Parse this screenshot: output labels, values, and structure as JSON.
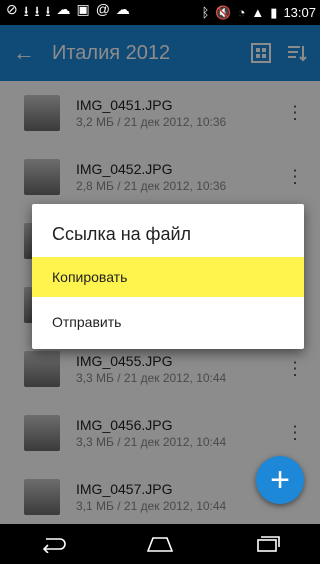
{
  "status_bar": {
    "time": "13:07"
  },
  "app_bar": {
    "title": "Италия 2012"
  },
  "files": [
    {
      "name": "IMG_0451.JPG",
      "meta": "3,2 МБ / 21 дек 2012, 10:36"
    },
    {
      "name": "IMG_0452.JPG",
      "meta": "2,8 МБ / 21 дек 2012, 10:36"
    },
    {
      "name": "IMG_0455.JPG",
      "meta": "3,3 МБ / 21 дек 2012, 10:44"
    },
    {
      "name": "IMG_0456.JPG",
      "meta": "3,3 МБ / 21 дек 2012, 10:44"
    },
    {
      "name": "IMG_0457.JPG",
      "meta": "3,1 МБ / 21 дек 2012, 10:44"
    }
  ],
  "dialog": {
    "title": "Ссылка на файл",
    "items": [
      {
        "label": "Копировать"
      },
      {
        "label": "Отправить"
      }
    ]
  },
  "icons": {
    "back": "arrow-left-icon",
    "grid": "grid-icon",
    "sort": "sort-icon",
    "add": "plus-icon"
  },
  "colors": {
    "primary": "#1e88d8",
    "highlight": "#fff34d"
  }
}
